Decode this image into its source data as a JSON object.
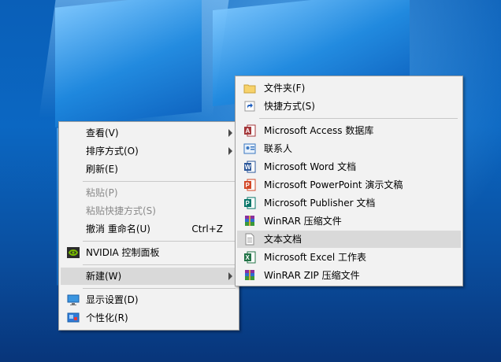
{
  "context_menu": {
    "items": [
      {
        "label": "查看(V)"
      },
      {
        "label": "排序方式(O)"
      },
      {
        "label": "刷新(E)"
      },
      {
        "label": "粘贴(P)"
      },
      {
        "label": "粘贴快捷方式(S)"
      },
      {
        "label": "撤消 重命名(U)",
        "shortcut": "Ctrl+Z"
      },
      {
        "label": "NVIDIA 控制面板",
        "icon": "nvidia-icon"
      },
      {
        "label": "新建(W)"
      },
      {
        "label": "显示设置(D)",
        "icon": "display-icon"
      },
      {
        "label": "个性化(R)",
        "icon": "personalize-icon"
      }
    ]
  },
  "new_submenu": {
    "items": [
      {
        "label": "文件夹(F)",
        "icon": "folder-icon"
      },
      {
        "label": "快捷方式(S)",
        "icon": "shortcut-icon"
      },
      {
        "label": "Microsoft Access 数据库",
        "icon": "access-icon"
      },
      {
        "label": "联系人",
        "icon": "contact-icon"
      },
      {
        "label": "Microsoft Word 文档",
        "icon": "word-icon"
      },
      {
        "label": "Microsoft PowerPoint 演示文稿",
        "icon": "powerpoint-icon"
      },
      {
        "label": "Microsoft Publisher 文档",
        "icon": "publisher-icon"
      },
      {
        "label": "WinRAR 压缩文件",
        "icon": "winrar-icon"
      },
      {
        "label": "文本文档",
        "icon": "text-document-icon"
      },
      {
        "label": "Microsoft Excel 工作表",
        "icon": "excel-icon"
      },
      {
        "label": "WinRAR ZIP 压缩文件",
        "icon": "winrar-zip-icon"
      }
    ]
  },
  "colors": {
    "menu_bg": "#f2f2f2",
    "highlight": "#d9d9d9",
    "disabled_text": "#8a8a8a",
    "desktop_blue": "#0b67c2"
  }
}
